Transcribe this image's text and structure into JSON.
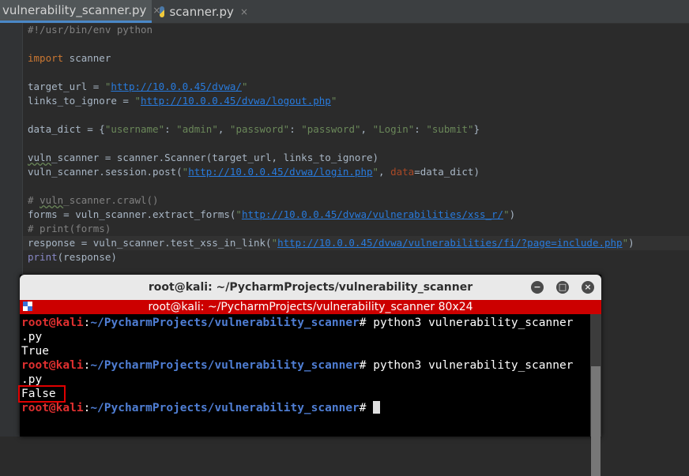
{
  "tabs": [
    {
      "label": "vulnerability_scanner.py",
      "close": "×"
    },
    {
      "label": "scanner.py",
      "close": "×"
    }
  ],
  "code": {
    "l1": "#!/usr/bin/env python",
    "l3_kw": "import",
    "l3_rest": " scanner",
    "l5_a": "target_url = ",
    "l5_url": "http://10.0.0.45/dvwa/",
    "l6_a": "links_to_ignore = ",
    "l6_url": "http://10.0.0.45/dvwa/logout.php",
    "l8_a": "data_dict = {",
    "l8_k1": "\"username\"",
    "l8_s1": ": ",
    "l8_v1": "\"admin\"",
    "l8_s2": ", ",
    "l8_k2": "\"password\"",
    "l8_s3": ": ",
    "l8_v2": "\"password\"",
    "l8_s4": ", ",
    "l8_k3": "\"Login\"",
    "l8_s5": ": ",
    "l8_v3": "\"submit\"",
    "l8_end": "}",
    "l10_a": "vuln",
    "l10_b": "_scanner = scanner.Scanner(target_url, links_to_ignore)",
    "l11_a": "vuln_scanner.session.post(",
    "l11_url": "http://10.0.0.45/dvwa/login.php",
    "l11_b": ", ",
    "l11_param": "data",
    "l11_c": "=data_dict)",
    "l13_a": "# ",
    "l13_b": "vuln",
    "l13_c": "_scanner.crawl()",
    "l14_a": "forms = vuln_scanner.extract_forms(",
    "l14_url": "http://10.0.0.45/dvwa/vulnerabilities/xss_r/",
    "l14_b": ")",
    "l15": "# print(forms)",
    "l16_a": "response = vuln_scanner.test_xss_in_link(",
    "l16_url": "http://10.0.0.45/dvwa/vulnerabilities/fi/?page=include.php",
    "l16_b": ")",
    "l17_kw": "print",
    "l17_rest": "(response)"
  },
  "terminal": {
    "title": "root@kali: ~/PycharmProjects/vulnerability_scanner",
    "subtitle": "root@kali: ~/PycharmProjects/vulnerability_scanner 80x24",
    "minimize": "−",
    "maximize": "□",
    "close": "×",
    "user": "root@kali",
    "colon": ":",
    "path": "~/PycharmProjects/vulnerability_scanner",
    "cmd": "# python3 vulnerability_scanner",
    "cont": ".py",
    "out1": "True",
    "out2": "False",
    "prompt_end": "# "
  },
  "colors": {
    "accent_red": "#cc0000",
    "highlight_box": "#e00000"
  }
}
